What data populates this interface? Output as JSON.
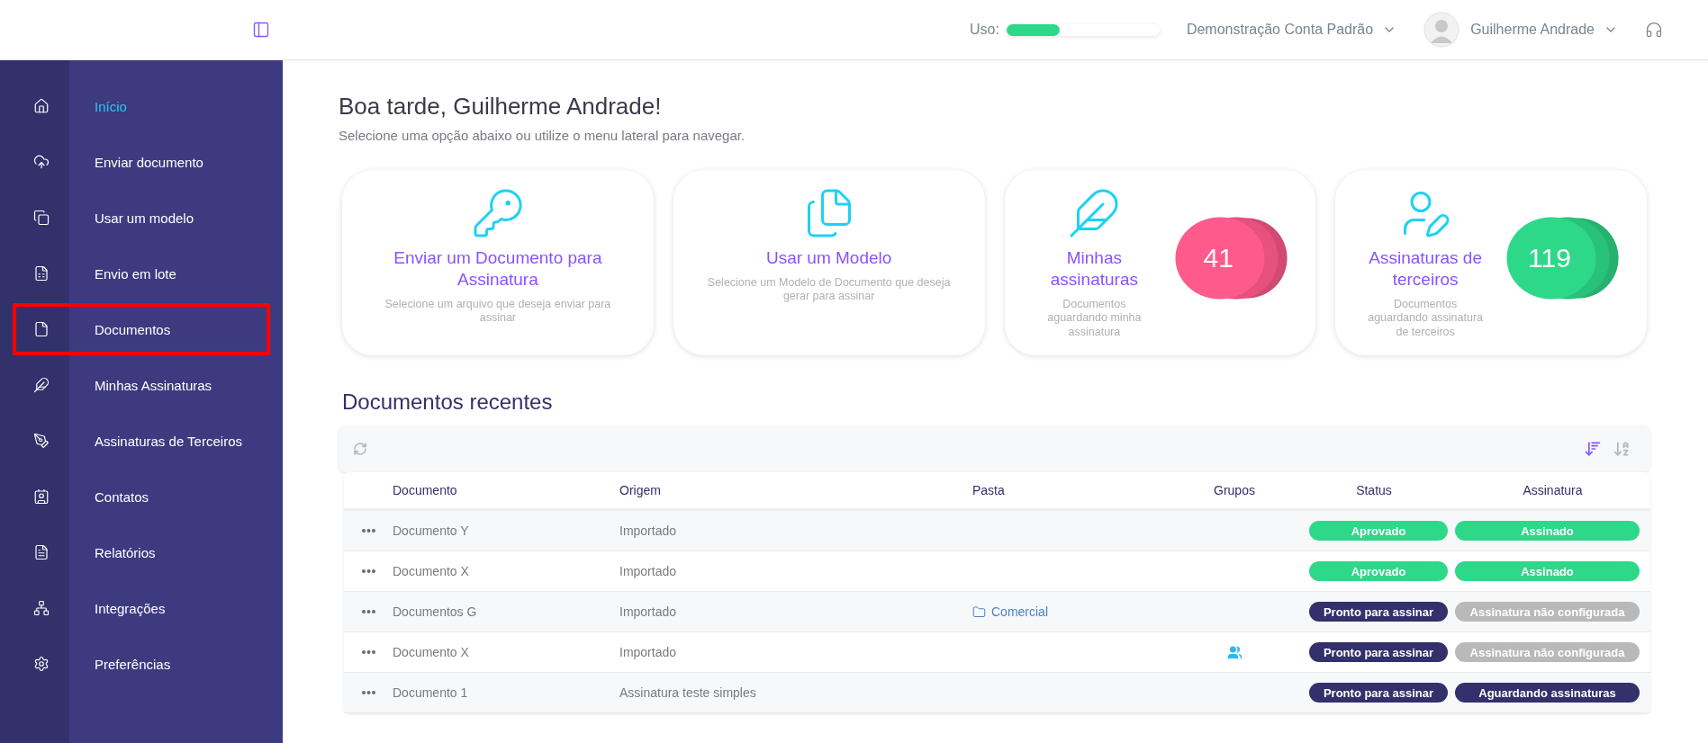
{
  "topbar": {
    "usage": {
      "label": "Uso:",
      "level": 0.35
    },
    "account": "Demonstração Conta Padrão",
    "user": "Guilherme Andrade"
  },
  "sidebar": {
    "items": [
      {
        "kind": "home",
        "label": "Início",
        "selected": true,
        "highlighted": false
      },
      {
        "kind": "upload",
        "label": "Enviar documento",
        "selected": false,
        "highlighted": false
      },
      {
        "kind": "template",
        "label": "Usar um modelo",
        "selected": false,
        "highlighted": false
      },
      {
        "kind": "batch",
        "label": "Envio em lote",
        "selected": false,
        "highlighted": false
      },
      {
        "kind": "document",
        "label": "Documentos",
        "selected": false,
        "highlighted": true
      },
      {
        "kind": "quill",
        "label": "Minhas Assinaturas",
        "selected": false,
        "highlighted": false
      },
      {
        "kind": "signers",
        "label": "Assinaturas de Terceiros",
        "selected": false,
        "highlighted": false
      },
      {
        "kind": "contacts",
        "label": "Contatos",
        "selected": false,
        "highlighted": false
      },
      {
        "kind": "reports",
        "label": "Relatórios",
        "selected": false,
        "highlighted": false
      },
      {
        "kind": "integrations",
        "label": "Integrações",
        "selected": false,
        "highlighted": false
      },
      {
        "kind": "settings",
        "label": "Preferências",
        "selected": false,
        "highlighted": false
      }
    ]
  },
  "greeting": {
    "title": "Boa tarde, Guilherme Andrade!",
    "subtitle": "Selecione uma opção abaixo ou utilize o menu lateral para navegar."
  },
  "cards": [
    {
      "kind": "action",
      "title": "Enviar um Documento para Assinatura",
      "description": "Selecione um arquivo que deseja enviar para assinar"
    },
    {
      "kind": "action",
      "title": "Usar um Modelo",
      "description": "Selecione um Modelo de Documento que deseja gerar para assinar"
    },
    {
      "kind": "counter",
      "title": "Minhas assinaturas",
      "description": "Documentos aguardando minha assinatura",
      "count": "41",
      "color": "#ff5a8c"
    },
    {
      "kind": "counter",
      "title": "Assinaturas de terceiros",
      "description": "Documentos aguardando assinatura de terceiros",
      "count": "119",
      "color": "#2ed889"
    }
  ],
  "recent": {
    "title": "Documentos recentes",
    "columns": [
      "Documento",
      "Origem",
      "Pasta",
      "Grupos",
      "Status",
      "Assinatura"
    ],
    "rows": [
      {
        "document": "Documento Y",
        "origin": "Importado",
        "groups": false,
        "status": {
          "label": "Aprovado",
          "color": "#2ed889"
        },
        "signature": {
          "label": "Assinado",
          "color": "#2ed889"
        }
      },
      {
        "document": "Documento X",
        "origin": "Importado",
        "groups": false,
        "status": {
          "label": "Aprovado",
          "color": "#2ed889"
        },
        "signature": {
          "label": "Assinado",
          "color": "#2ed889"
        }
      },
      {
        "document": "Documentos G",
        "origin": "Importado",
        "folder": "Comercial",
        "groups": false,
        "status": {
          "label": "Pronto para assinar",
          "color": "#33306b"
        },
        "signature": {
          "label": "Assinatura não configurada",
          "color": "#b9b9b9"
        }
      },
      {
        "document": "Documento X",
        "origin": "Importado",
        "groups": true,
        "status": {
          "label": "Pronto para assinar",
          "color": "#33306b"
        },
        "signature": {
          "label": "Assinatura não configurada",
          "color": "#b9b9b9"
        }
      },
      {
        "document": "Documento 1",
        "origin": "Assinatura teste simples",
        "groups": false,
        "status": {
          "label": "Pronto para assinar",
          "color": "#33306b"
        },
        "signature": {
          "label": "Aguardando assinaturas",
          "color": "#33306b"
        }
      }
    ]
  }
}
